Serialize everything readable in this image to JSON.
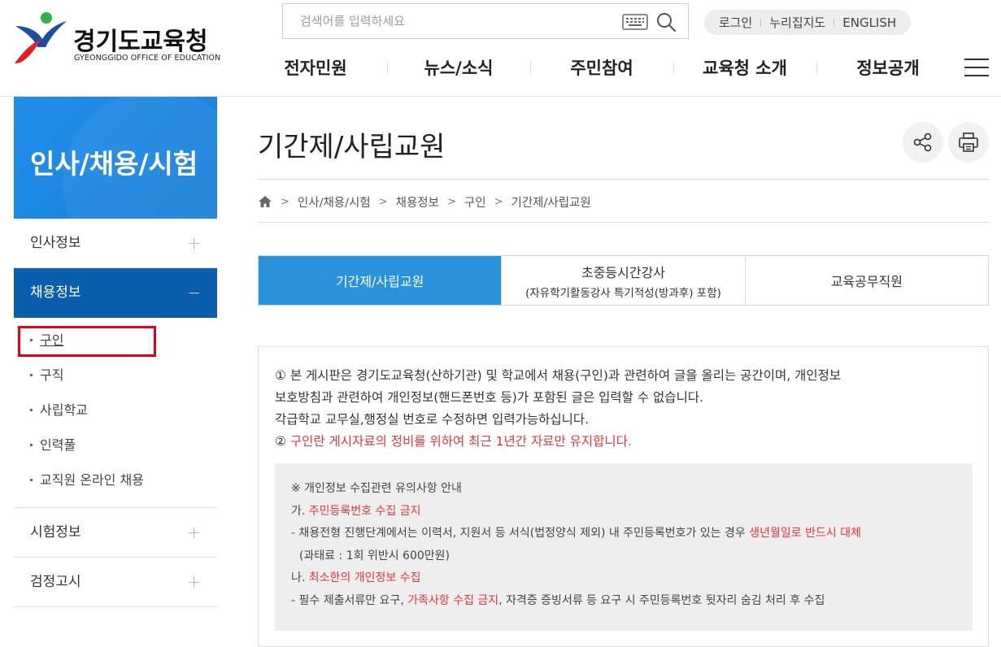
{
  "header": {
    "logo_title": "경기도교육청",
    "logo_subtitle": "GYEONGGIDO OFFICE OF EDUCATION",
    "search_placeholder": "검색어를 입력하세요",
    "util": [
      "로그인",
      "누리집지도",
      "ENGLISH"
    ],
    "gnb": [
      "전자민원",
      "뉴스/소식",
      "주민참여",
      "교육청 소개",
      "정보공개"
    ]
  },
  "sidebar": {
    "title": "인사/채용/시험",
    "items": [
      {
        "label": "인사정보",
        "toggle": "+"
      },
      {
        "label": "채용정보",
        "toggle": "−"
      },
      {
        "label": "시험정보",
        "toggle": "+"
      },
      {
        "label": "검정고시",
        "toggle": "+"
      }
    ],
    "sub_items": [
      "구인",
      "구직",
      "사립학교",
      "인력풀",
      "교직원 온라인 채용"
    ]
  },
  "content": {
    "title": "기간제/사립교원",
    "breadcrumb": [
      "인사/채용/시험",
      "채용정보",
      "구인",
      "기간제/사립교원"
    ],
    "tabs": [
      {
        "label": "기간제/사립교원",
        "sub": ""
      },
      {
        "label": "초중등시간강사",
        "sub": "(자유학기활동강사 특기적성(방과후) 포함)"
      },
      {
        "label": "교육공무직원",
        "sub": ""
      }
    ],
    "notice": {
      "line1": "① 본 게시판은 경기도교육청(산하기관) 및 학교에서 채용(구인)과 관련하여 글을 올리는 공간이며, 개인정보",
      "line2": "보호방침과 관련하여 개인정보(핸드폰번호 등)가 포함된 글은 입력할 수 없습니다.",
      "line3": "각급학교 교무실,행정실 번호로 수정하면 입력가능하십니다.",
      "line4_num": "②",
      "line4": "구인란 게시자료의 정비를 위하여 최근 1년간 자료만 유지합니다."
    },
    "privacy": {
      "heading": "※ 개인정보 수집관련 유의사항 안내",
      "a_prefix": "가.",
      "a_title": "주민등록번호 수집 금지",
      "a_desc": "- 채용전형 진행단계에서는 이력서, 지원서 등 서식(법정양식 제외) 내 주민등록번호가 있는 경우",
      "a_desc_red": "생년월일로 반드시 대체",
      "a_fine": "(과태료 : 1회 위반시 600만원)",
      "b_prefix": "나.",
      "b_title": "최소한의 개인정보 수집",
      "b_desc1": "- 필수 제출서류만 요구,",
      "b_desc_red": "가족사항 수집 금지",
      "b_desc2": ", 자격증 증빙서류 등 요구 시 주민등록번호 뒷자리 숨김 처리 후 수집"
    }
  },
  "colors": {
    "brand_blue": "#1f8ee8",
    "active_nav": "#0a5ead",
    "active_tab": "#2a92dc",
    "warning_red": "#e8343a",
    "highlight_box": "#e60012"
  },
  "icons": [
    "keyboard-icon",
    "search-icon",
    "hamburger-icon",
    "share-icon",
    "print-icon",
    "home-icon"
  ]
}
